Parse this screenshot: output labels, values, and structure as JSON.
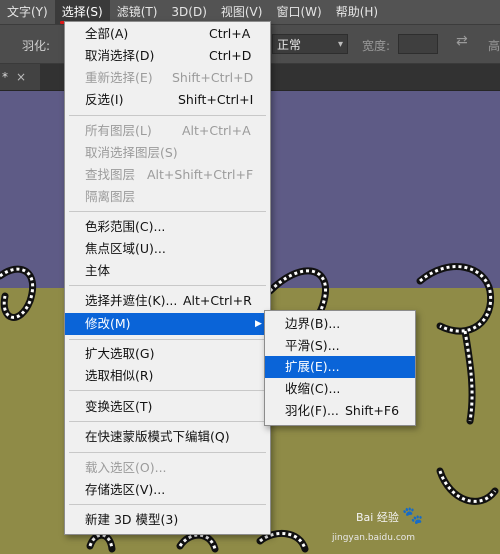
{
  "menubar": {
    "items": [
      "文字(Y)",
      "选择(S)",
      "滤镜(T)",
      "3D(D)",
      "视图(V)",
      "窗口(W)",
      "帮助(H)"
    ],
    "active": "选择(S)"
  },
  "options": {
    "feather_label": "羽化:",
    "style_value": "正常",
    "width_label": "宽度:",
    "height_label": "高"
  },
  "tab": {
    "marker": "*",
    "close": "×"
  },
  "select_menu": {
    "items": [
      {
        "label": "全部(A)",
        "shortcut": "Ctrl+A"
      },
      {
        "label": "取消选择(D)",
        "shortcut": "Ctrl+D"
      },
      {
        "label": "重新选择(E)",
        "shortcut": "Shift+Ctrl+D"
      },
      {
        "label": "反选(I)",
        "shortcut": "Shift+Ctrl+I"
      },
      {
        "label": "所有图层(L)",
        "shortcut": "Alt+Ctrl+A"
      },
      {
        "label": "取消选择图层(S)",
        "shortcut": ""
      },
      {
        "label": "查找图层",
        "shortcut": "Alt+Shift+Ctrl+F"
      },
      {
        "label": "隔离图层",
        "shortcut": ""
      },
      {
        "label": "色彩范围(C)...",
        "shortcut": ""
      },
      {
        "label": "焦点区域(U)...",
        "shortcut": ""
      },
      {
        "label": "主体",
        "shortcut": ""
      },
      {
        "label": "选择并遮住(K)...",
        "shortcut": "Alt+Ctrl+R"
      },
      {
        "label": "修改(M)",
        "shortcut": ""
      },
      {
        "label": "扩大选取(G)",
        "shortcut": ""
      },
      {
        "label": "选取相似(R)",
        "shortcut": ""
      },
      {
        "label": "变换选区(T)",
        "shortcut": ""
      },
      {
        "label": "在快速蒙版模式下编辑(Q)",
        "shortcut": ""
      },
      {
        "label": "载入选区(O)...",
        "shortcut": ""
      },
      {
        "label": "存储选区(V)...",
        "shortcut": ""
      },
      {
        "label": "新建 3D 模型(3)",
        "shortcut": ""
      }
    ]
  },
  "modify_submenu": {
    "items": [
      {
        "label": "边界(B)...",
        "shortcut": ""
      },
      {
        "label": "平滑(S)...",
        "shortcut": ""
      },
      {
        "label": "扩展(E)...",
        "shortcut": ""
      },
      {
        "label": "收缩(C)...",
        "shortcut": ""
      },
      {
        "label": "羽化(F)...",
        "shortcut": "Shift+F6"
      }
    ]
  },
  "watermark": {
    "brand": "Bai 经验",
    "url": "jingyan.baidu.com"
  },
  "colors": {
    "menu_highlight": "#0a64d8",
    "sky": "#5e5b86",
    "ground": "#8f8b47",
    "underline": "#e01919"
  }
}
